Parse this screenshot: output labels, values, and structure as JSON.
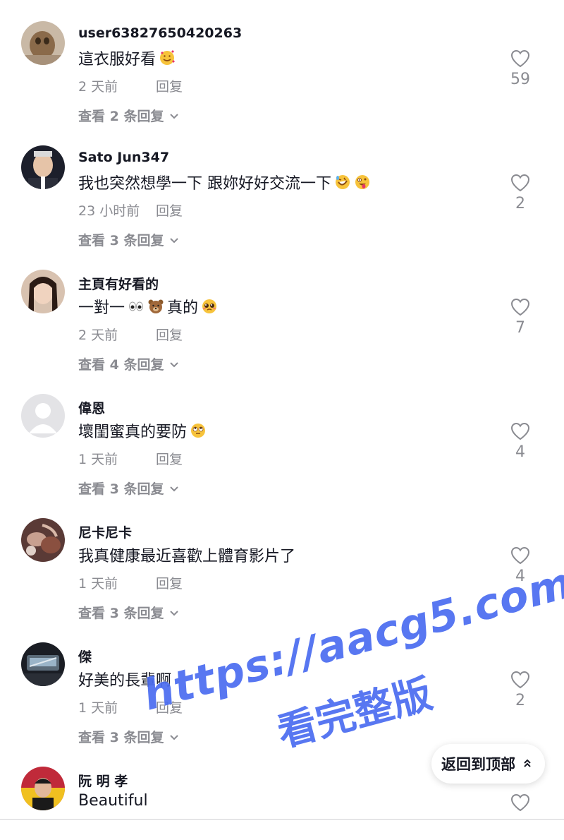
{
  "comments": [
    {
      "username": "user63827650420263",
      "text": "這衣服好看",
      "emoji_after": [
        "smiling-face-with-hearts-emoji"
      ],
      "time": "2 天前",
      "reply_label": "回复",
      "view_replies": "查看 2 条回复",
      "likes": "59",
      "avatar": "dog-photo-avatar"
    },
    {
      "username": "Sato Jun347",
      "text": "我也突然想學一下 跟妳好好交流一下",
      "emoji_after": [
        "rolling-laughing-emoji",
        "zany-face-emoji"
      ],
      "time": "23 小时前",
      "reply_label": "回复",
      "view_replies": "查看 3 条回复",
      "likes": "2",
      "avatar": "man-photo-avatar"
    },
    {
      "username": "主頁有好看的",
      "text_parts": [
        "一對一",
        "真的"
      ],
      "emoji_inline": [
        "eyes-emoji",
        "bear-emoji",
        "pleading-face-emoji"
      ],
      "time": "2 天前",
      "reply_label": "回复",
      "view_replies": "查看 4 条回复",
      "likes": "7",
      "avatar": "woman-photo-avatar"
    },
    {
      "username": "偉恩",
      "text": "壞閨蜜真的要防",
      "emoji_after": [
        "rolling-eyes-emoji"
      ],
      "time": "1 天前",
      "reply_label": "回复",
      "view_replies": "查看 3 条回复",
      "likes": "4",
      "avatar": "default-avatar"
    },
    {
      "username": "尼卡尼卡",
      "text": "我真健康最近喜歡上體育影片了",
      "time": "1 天前",
      "reply_label": "回复",
      "view_replies": "查看 3 条回复",
      "likes": "4",
      "avatar": "food-photo-avatar"
    },
    {
      "username": "傑",
      "text": "好美的長輩啊",
      "time": "1 天前",
      "reply_label": "回复",
      "view_replies": "查看 3 条回复",
      "likes": "2",
      "avatar": "car-photo-avatar"
    },
    {
      "username": "阮 明 孝",
      "text": "Beautiful",
      "avatar": "person-photo-avatar"
    }
  ],
  "watermark": {
    "url": "https://aacg5.com",
    "subtitle": "看完整版"
  },
  "back_to_top": {
    "label": "返回到顶部",
    "icon": "double-chevron-up-icon"
  },
  "colors": {
    "text_primary": "#161823",
    "text_secondary": "#8a8b91",
    "watermark": "#4a6cf0"
  }
}
